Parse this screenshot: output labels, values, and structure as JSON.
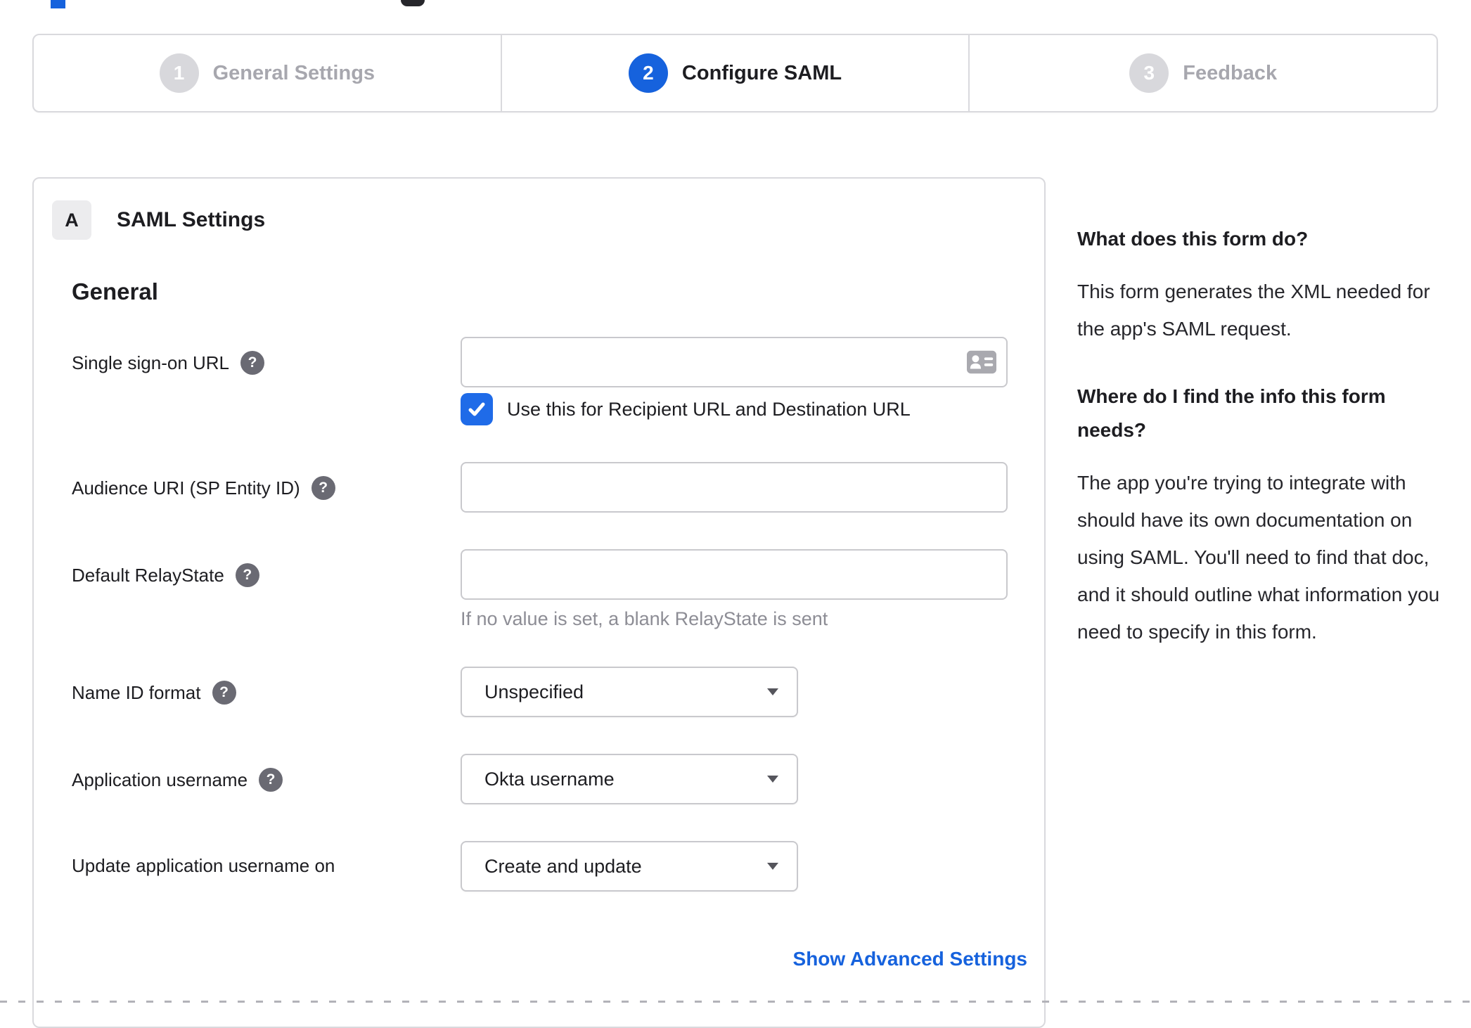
{
  "colors": {
    "accent_blue": "#1662dd",
    "checkbox_blue": "#1f6be8",
    "inactive_step_gray": "#d8d8dc",
    "border_gray": "#d9d9dd"
  },
  "icons": {
    "help": "?"
  },
  "stepper": {
    "steps": [
      {
        "number": "1",
        "label": "General Settings",
        "state": "inactive"
      },
      {
        "number": "2",
        "label": "Configure SAML",
        "state": "active"
      },
      {
        "number": "3",
        "label": "Feedback",
        "state": "inactive"
      }
    ]
  },
  "panel": {
    "badge": "A",
    "title": "SAML Settings",
    "subsection": "General",
    "fields": [
      {
        "label": "Single sign-on URL",
        "type": "text",
        "value": "",
        "checkbox_checked": true,
        "checkbox_label": "Use this for Recipient URL and Destination URL"
      },
      {
        "label": "Audience URI (SP Entity ID)",
        "type": "text",
        "value": ""
      },
      {
        "label": "Default RelayState",
        "type": "text",
        "value": "",
        "hint": "If no value is set, a blank RelayState is sent"
      },
      {
        "label": "Name ID format",
        "type": "select",
        "value": "Unspecified"
      },
      {
        "label": "Application username",
        "type": "select",
        "value": "Okta username"
      },
      {
        "label": "Update application username on",
        "type": "select",
        "value": "Create and update"
      }
    ],
    "advanced_link": "Show Advanced Settings"
  },
  "sidebar": {
    "sections": [
      {
        "heading": "What does this form do?",
        "body": "This form generates the XML needed for the app's SAML request."
      },
      {
        "heading": "Where do I find the info this form needs?",
        "body": "The app you're trying to integrate with should have its own documentation on using SAML. You'll need to find that doc, and it should outline what information you need to specify in this form."
      }
    ]
  }
}
